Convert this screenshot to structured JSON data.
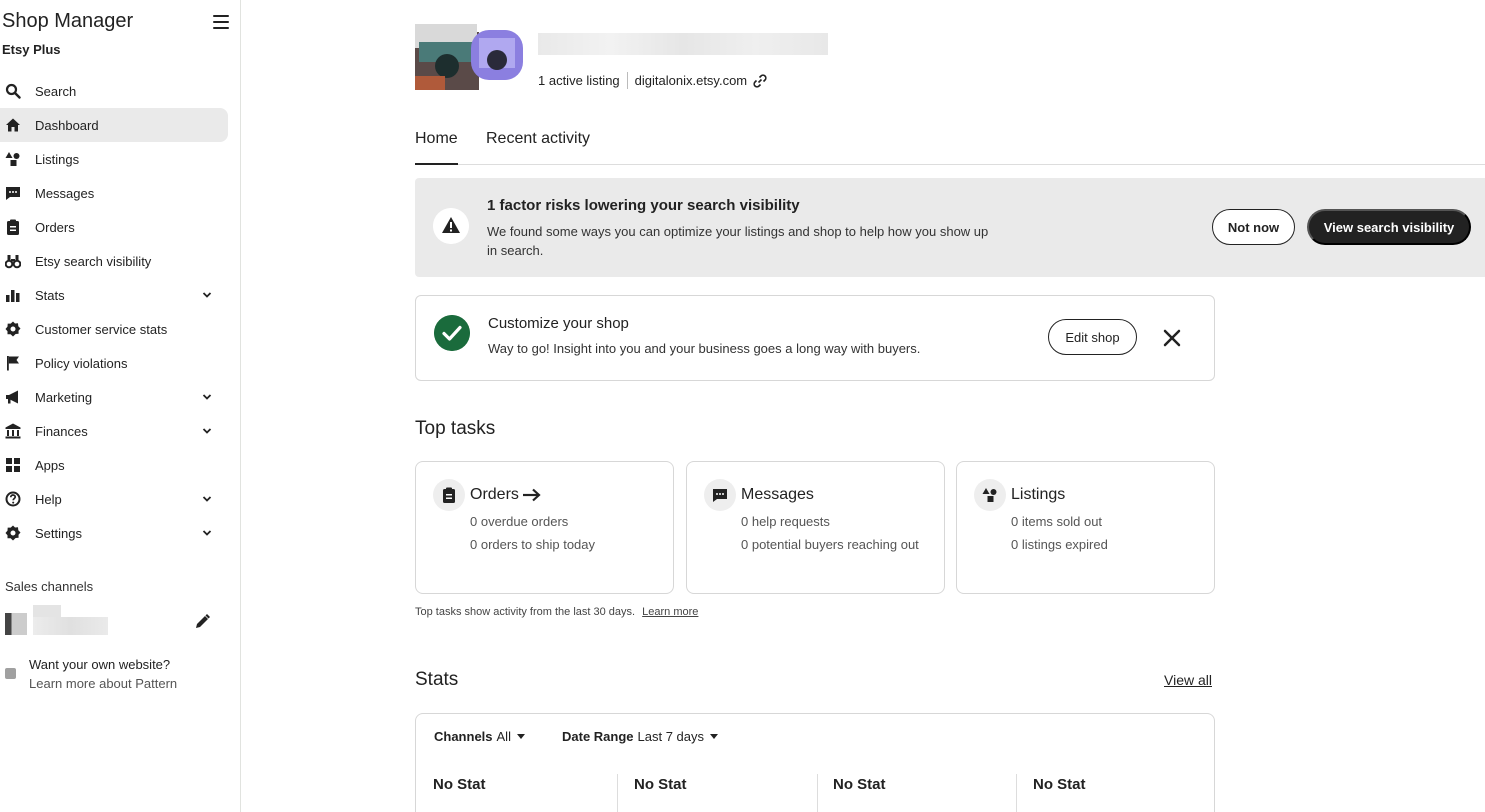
{
  "sidebar": {
    "title": "Shop Manager",
    "subtitle": "Etsy Plus",
    "items": [
      {
        "label": "Search"
      },
      {
        "label": "Dashboard"
      },
      {
        "label": "Listings"
      },
      {
        "label": "Messages"
      },
      {
        "label": "Orders"
      },
      {
        "label": "Etsy search visibility"
      },
      {
        "label": "Stats"
      },
      {
        "label": "Customer service stats"
      },
      {
        "label": "Policy violations"
      },
      {
        "label": "Marketing"
      },
      {
        "label": "Finances"
      },
      {
        "label": "Apps"
      },
      {
        "label": "Help"
      },
      {
        "label": "Settings"
      }
    ],
    "sales_channels_label": "Sales channels",
    "pattern_line1": "Want your own website?",
    "pattern_line2": "Learn more about Pattern"
  },
  "shop": {
    "active_listings": "1 active listing",
    "url": "digitalonix.etsy.com"
  },
  "tabs": [
    "Home",
    "Recent activity"
  ],
  "alert": {
    "title": "1 factor risks lowering your search visibility",
    "body": "We found some ways you can optimize your listings and shop to help how you show up in search.",
    "not_now": "Not now",
    "view": "View search visibility"
  },
  "customize": {
    "title": "Customize your shop",
    "body": "Way to go! Insight into you and your business goes a long way with buyers.",
    "edit": "Edit shop"
  },
  "top_tasks": {
    "heading": "Top tasks",
    "cards": [
      {
        "title": "Orders",
        "lines": [
          "0 overdue orders",
          "0 orders to ship today"
        ]
      },
      {
        "title": "Messages",
        "lines": [
          "0 help requests",
          "0 potential buyers reaching out"
        ]
      },
      {
        "title": "Listings",
        "lines": [
          "0 items sold out",
          "0 listings expired"
        ]
      }
    ],
    "note": "Top tasks show activity from the last 30 days.",
    "learn_more": "Learn more"
  },
  "stats": {
    "heading": "Stats",
    "view_all": "View all",
    "channels_label": "Channels",
    "channels_value": "All",
    "date_label": "Date Range",
    "date_value": "Last 7 days",
    "tiles": [
      "No Stat",
      "No Stat",
      "No Stat",
      "No Stat"
    ]
  },
  "colors": {
    "primary_dark": "#222222",
    "success": "#1a6b3c",
    "alert_bg": "#eaeaea"
  }
}
